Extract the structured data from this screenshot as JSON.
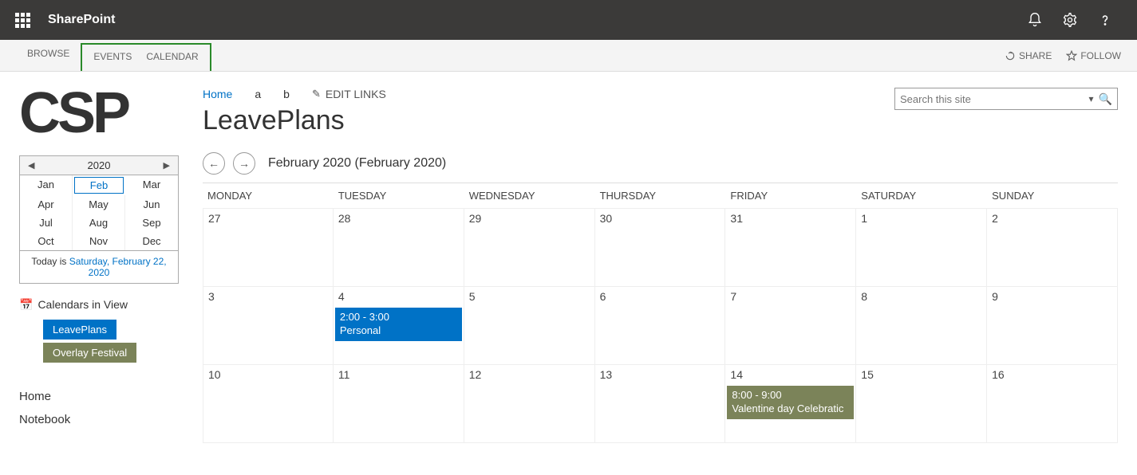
{
  "suite": {
    "brand": "SharePoint"
  },
  "ribbon": {
    "browse": "BROWSE",
    "events": "EVENTS",
    "calendar": "CALENDAR",
    "share": "SHARE",
    "follow": "FOLLOW"
  },
  "logo": "CSP",
  "breadcrumb": {
    "home": "Home",
    "a": "a",
    "b": "b",
    "edit": "EDIT LINKS"
  },
  "page_title": "LeavePlans",
  "search": {
    "placeholder": "Search this site"
  },
  "mini_cal": {
    "year": "2020",
    "months": [
      "Jan",
      "Feb",
      "Mar",
      "Apr",
      "May",
      "Jun",
      "Jul",
      "Aug",
      "Sep",
      "Oct",
      "Nov",
      "Dec"
    ],
    "selected": "Feb",
    "today_prefix": "Today is ",
    "today_link": "Saturday, February 22, 2020"
  },
  "calendars_in_view": {
    "title": "Calendars in View",
    "items": [
      {
        "label": "LeavePlans",
        "color": "blue"
      },
      {
        "label": "Overlay Festival",
        "color": "olive"
      }
    ]
  },
  "side_nav": [
    "Home",
    "Notebook"
  ],
  "cal_header": "February 2020 (February 2020)",
  "day_headers": [
    "MONDAY",
    "TUESDAY",
    "WEDNESDAY",
    "THURSDAY",
    "FRIDAY",
    "SATURDAY",
    "SUNDAY"
  ],
  "weeks": [
    [
      "27",
      "28",
      "29",
      "30",
      "31",
      "1",
      "2"
    ],
    [
      "3",
      "4",
      "5",
      "6",
      "7",
      "8",
      "9"
    ],
    [
      "10",
      "11",
      "12",
      "13",
      "14",
      "15",
      "16"
    ]
  ],
  "events": {
    "week1_tue": {
      "time": "2:00 - 3:00",
      "title": "Personal"
    },
    "week2_fri": {
      "time": "8:00 - 9:00",
      "title": "Valentine day Celebratic"
    }
  }
}
